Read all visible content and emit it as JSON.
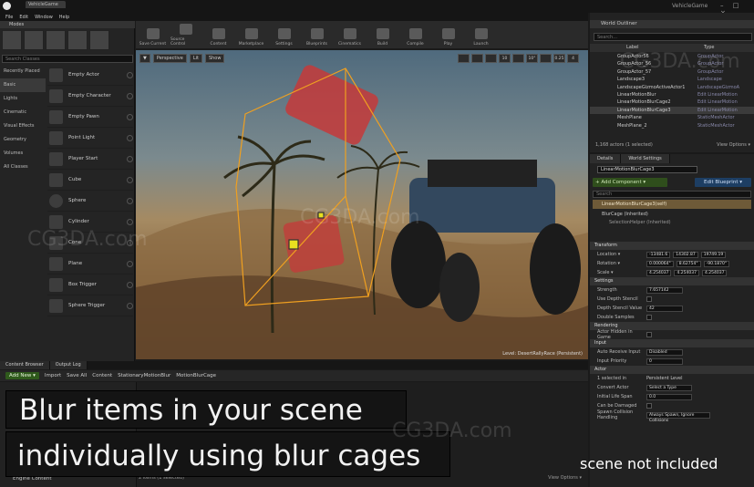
{
  "window": {
    "project_tab": "VehicleGame",
    "app_name": "VehicleGame",
    "controls": "– □ ×"
  },
  "menu": [
    "File",
    "Edit",
    "Window",
    "Help"
  ],
  "modes": {
    "title": "Modes",
    "search_placeholder": "Search Classes",
    "categories": [
      "Recently Placed",
      "Basic",
      "Lights",
      "Cinematic",
      "Visual Effects",
      "Geometry",
      "Volumes",
      "All Classes"
    ],
    "selected_category": "Basic",
    "items": [
      "Empty Actor",
      "Empty Character",
      "Empty Pawn",
      "Point Light",
      "Player Start",
      "Cube",
      "Sphere",
      "Cylinder",
      "Cone",
      "Plane",
      "Box Trigger",
      "Sphere Trigger"
    ]
  },
  "toolbar": [
    "Save Current",
    "Source Control",
    "Content",
    "Marketplace",
    "Settings",
    "Blueprints",
    "Cinematics",
    "Build",
    "Compile",
    "Play",
    "Launch"
  ],
  "viewport": {
    "buttons": [
      "▼",
      "Perspective",
      "Lit",
      "Show"
    ],
    "right_buttons": [
      "",
      "",
      "",
      "10",
      "",
      "10°",
      "",
      "0.25",
      "4"
    ],
    "level_label": "Level: DesertRallyRace (Persistent)"
  },
  "outliner": {
    "title": "World Outliner",
    "search_placeholder": "Search...",
    "col_label": "Label",
    "col_type": "Type",
    "rows": [
      {
        "name": "GroupActor56",
        "type": "GroupActor"
      },
      {
        "name": "GroupActor_56",
        "type": "GroupActor"
      },
      {
        "name": "GroupActor_57",
        "type": "GroupActor"
      },
      {
        "name": "Landscape3",
        "type": "Landscape"
      },
      {
        "name": "LandscapeGizmoActiveActor1",
        "type": "LandscapeGizmoA"
      },
      {
        "name": "LinearMotionBlur",
        "type": "Edit LinearMotion"
      },
      {
        "name": "LinearMotionBlurCage2",
        "type": "Edit LinearMotion"
      },
      {
        "name": "LinearMotionBlurCage3",
        "type": "Edit LinearMotion"
      },
      {
        "name": "MeshPlane",
        "type": "StaticMeshActor"
      },
      {
        "name": "MeshPlane_2",
        "type": "StaticMeshActor"
      }
    ],
    "selected_row": 7,
    "footer": "1,168 actors (1 selected)",
    "view_options": "View Options ▾"
  },
  "details": {
    "tabs": [
      "Details",
      "World Settings"
    ],
    "actor_name": "LinearMotionBlurCage3",
    "add_component": "+ Add Component ▾",
    "edit_blueprint": "Edit Blueprint ▾",
    "search_placeholder": "Search",
    "component_self": "LinearMotionBlurCage3(self)",
    "components": [
      "BlurCage (Inherited)",
      "SelectionHelper (Inherited)"
    ],
    "transform": {
      "section": "Transform",
      "location_label": "Location ▾",
      "location": [
        "-13481.6",
        "14302.87",
        "19749.19"
      ],
      "rotation_label": "Rotation ▾",
      "rotation": [
        "0.000064°",
        "8.62754°",
        "-90.1870°"
      ],
      "scale_label": "Scale ▾",
      "scale": [
        "4.254037",
        "4.254037",
        "4.254037"
      ]
    },
    "settings": {
      "section": "Settings",
      "strength_label": "Strength",
      "strength": "7.657142",
      "depth_stencil_label": "Use Depth Stencil",
      "stencil_value_label": "Depth Stencil Value",
      "stencil_value": "42",
      "double_samples_label": "Double Samples"
    },
    "rendering": {
      "section": "Rendering",
      "hidden_label": "Actor Hidden in Game"
    },
    "input": {
      "section": "Input",
      "auto_receive_label": "Auto Receive Input",
      "auto_receive": "Disabled",
      "priority_label": "Input Priority",
      "priority": "0"
    },
    "actor": {
      "section": "Actor",
      "selected_in_label": "1 selected in",
      "selected_in": "Persistent Level",
      "convert_label": "Convert Actor",
      "convert": "Select a Type",
      "lifespan_label": "Initial Life Span",
      "lifespan": "0.0",
      "damaged_label": "Can be Damaged",
      "spawn_label": "Spawn Collision Handling",
      "spawn": "Always Spawn, Ignore Collisions"
    }
  },
  "content_browser": {
    "tabs": [
      "Content Browser",
      "Output Log"
    ],
    "add_new": "Add New ▾",
    "import": "Import",
    "save_all": "Save All",
    "path": [
      "Content",
      "StationaryMotionBlur",
      "MotionBlurCage"
    ],
    "tree_root": "Engine Content",
    "footer": "2 items (1 selected)",
    "view_options": "View Options ▾"
  },
  "overlay": {
    "line1": "Blur items in your scene",
    "line2": "individually using blur cages",
    "note": "scene not included",
    "watermark": "CG3DA.com"
  },
  "colors": {
    "accent_green": "#2f5a1c",
    "accent_blue": "#1d3e63",
    "selection": "#6e5a38",
    "motion_blur_cage": "#f0a020"
  }
}
